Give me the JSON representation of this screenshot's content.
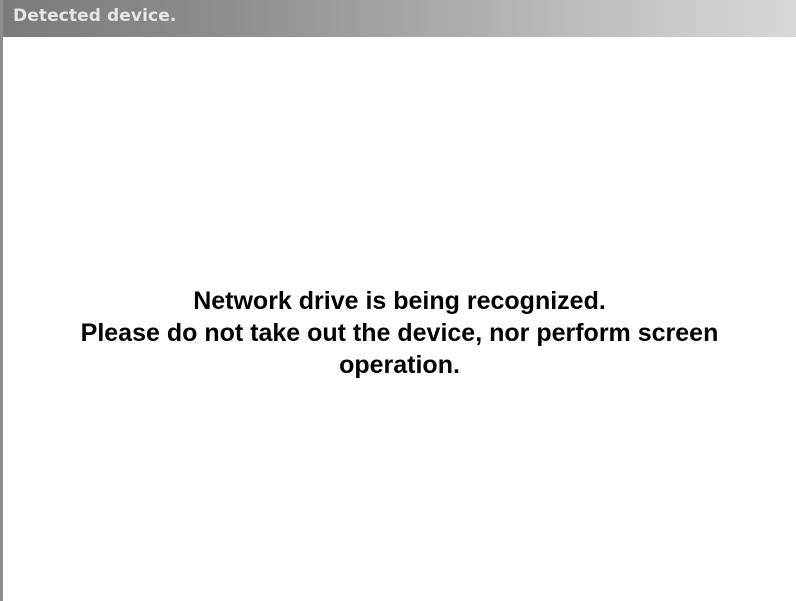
{
  "dialog": {
    "title": "Detected device.",
    "message_line1": "Network drive is being recognized.",
    "message_line2": "Please do not take out the device, nor perform screen operation."
  },
  "colors": {
    "titlebar_start": "#7b7b7b",
    "titlebar_end": "#d8d8d8",
    "title_text": "#e6e6e6",
    "background": "#ffffff",
    "message_text": "#000000"
  }
}
